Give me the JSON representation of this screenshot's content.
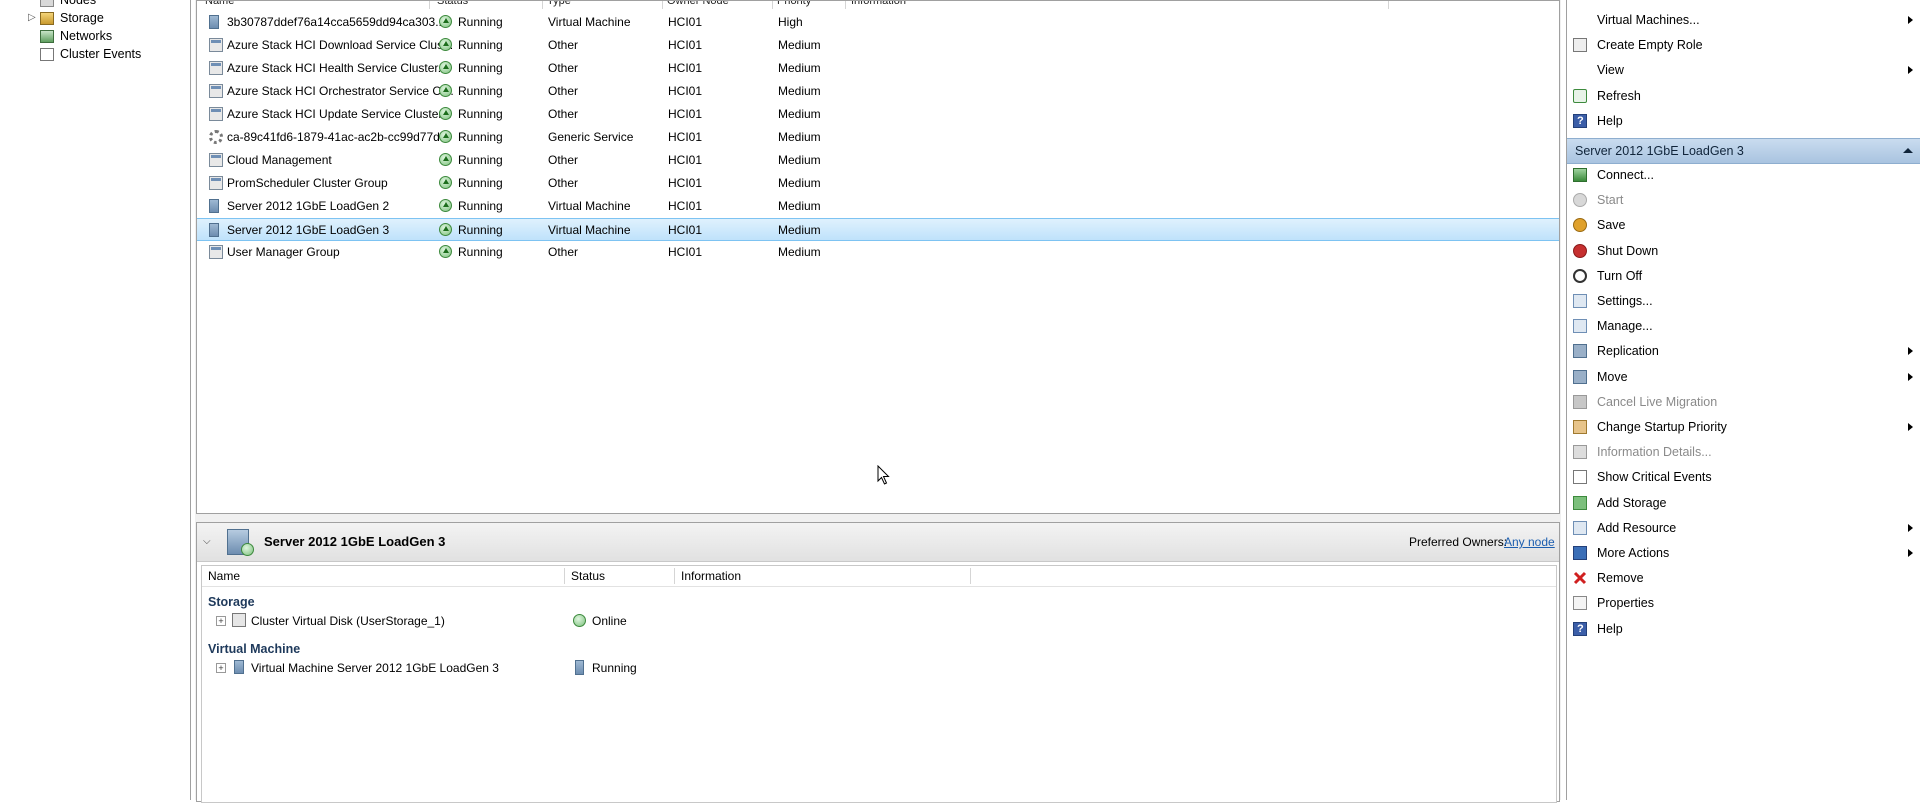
{
  "tree": {
    "items": [
      {
        "label": "Nodes",
        "icon": "nodes-icon"
      },
      {
        "label": "Storage",
        "icon": "storage-icon"
      },
      {
        "label": "Networks",
        "icon": "networks-icon"
      },
      {
        "label": "Cluster Events",
        "icon": "cluster-events-icon"
      }
    ]
  },
  "roles": {
    "columns": [
      "Name",
      "Status",
      "Type",
      "Owner Node",
      "Priority",
      "Information"
    ],
    "rows": [
      {
        "name": "3b30787ddef76a14cca5659dd94ca303...",
        "status": "Running",
        "type": "Virtual Machine",
        "owner": "HCI01",
        "priority": "High",
        "icon": "vm"
      },
      {
        "name": "Azure Stack HCI Download Service Clus...",
        "status": "Running",
        "type": "Other",
        "owner": "HCI01",
        "priority": "Medium",
        "icon": "role"
      },
      {
        "name": "Azure Stack HCI Health Service Cluster...",
        "status": "Running",
        "type": "Other",
        "owner": "HCI01",
        "priority": "Medium",
        "icon": "role"
      },
      {
        "name": "Azure Stack HCI Orchestrator Service Cl...",
        "status": "Running",
        "type": "Other",
        "owner": "HCI01",
        "priority": "Medium",
        "icon": "role"
      },
      {
        "name": "Azure Stack HCI Update Service Cluster...",
        "status": "Running",
        "type": "Other",
        "owner": "HCI01",
        "priority": "Medium",
        "icon": "role"
      },
      {
        "name": "ca-89c41fd6-1879-41ac-ac2b-cc99d77d...",
        "status": "Running",
        "type": "Generic Service",
        "owner": "HCI01",
        "priority": "Medium",
        "icon": "gear"
      },
      {
        "name": "Cloud Management",
        "status": "Running",
        "type": "Other",
        "owner": "HCI01",
        "priority": "Medium",
        "icon": "role"
      },
      {
        "name": "PromScheduler Cluster Group",
        "status": "Running",
        "type": "Other",
        "owner": "HCI01",
        "priority": "Medium",
        "icon": "role"
      },
      {
        "name": "Server 2012 1GbE LoadGen 2",
        "status": "Running",
        "type": "Virtual Machine",
        "owner": "HCI01",
        "priority": "Medium",
        "icon": "vm"
      },
      {
        "name": "Server 2012 1GbE LoadGen 3",
        "status": "Running",
        "type": "Virtual Machine",
        "owner": "HCI01",
        "priority": "Medium",
        "icon": "vm",
        "selected": true
      },
      {
        "name": "User Manager Group",
        "status": "Running",
        "type": "Other",
        "owner": "HCI01",
        "priority": "Medium",
        "icon": "role"
      }
    ]
  },
  "details": {
    "title": "Server 2012 1GbE LoadGen 3",
    "preferred_owners_label": "Preferred Owners:",
    "preferred_owners_link": "Any node",
    "columns": [
      "Name",
      "Status",
      "Information"
    ],
    "groups": [
      {
        "label": "Storage",
        "items": [
          {
            "name": "Cluster Virtual Disk (UserStorage_1)",
            "status": "Online"
          }
        ]
      },
      {
        "label": "Virtual Machine",
        "items": [
          {
            "name": "Virtual Machine Server 2012 1GbE LoadGen 3",
            "status": "Running"
          }
        ]
      }
    ]
  },
  "actions": {
    "top": [
      {
        "label": "Virtual Machines...",
        "submenu": true,
        "icon": ""
      },
      {
        "label": "Create Empty Role",
        "icon": "create-role-icon"
      },
      {
        "label": "View",
        "submenu": true,
        "icon": ""
      },
      {
        "label": "Refresh",
        "icon": "refresh-icon"
      },
      {
        "label": "Help",
        "icon": "help-icon"
      }
    ],
    "section_title": "Server 2012 1GbE LoadGen 3",
    "section": [
      {
        "label": "Connect...",
        "icon": "connect-icon"
      },
      {
        "label": "Start",
        "icon": "start-icon",
        "disabled": true
      },
      {
        "label": "Save",
        "icon": "save-icon"
      },
      {
        "label": "Shut Down",
        "icon": "shut-down-icon"
      },
      {
        "label": "Turn Off",
        "icon": "turn-off-icon"
      },
      {
        "label": "Settings...",
        "icon": "settings-icon"
      },
      {
        "label": "Manage...",
        "icon": "manage-icon"
      },
      {
        "label": "Replication",
        "icon": "replication-icon",
        "submenu": true
      },
      {
        "label": "Move",
        "icon": "move-icon",
        "submenu": true
      },
      {
        "label": "Cancel Live Migration",
        "icon": "cancel-migration-icon",
        "disabled": true
      },
      {
        "label": "Change Startup Priority",
        "icon": "startup-priority-icon",
        "submenu": true
      },
      {
        "label": "Information Details...",
        "icon": "information-icon",
        "disabled": true
      },
      {
        "label": "Show Critical Events",
        "icon": "critical-events-icon"
      },
      {
        "label": "Add Storage",
        "icon": "add-storage-icon"
      },
      {
        "label": "Add Resource",
        "icon": "add-resource-icon",
        "submenu": true
      },
      {
        "label": "More Actions",
        "icon": "more-actions-icon",
        "submenu": true
      },
      {
        "label": "Remove",
        "icon": "remove-icon"
      },
      {
        "label": "Properties",
        "icon": "properties-icon"
      },
      {
        "label": "Help",
        "icon": "help-icon"
      }
    ]
  }
}
